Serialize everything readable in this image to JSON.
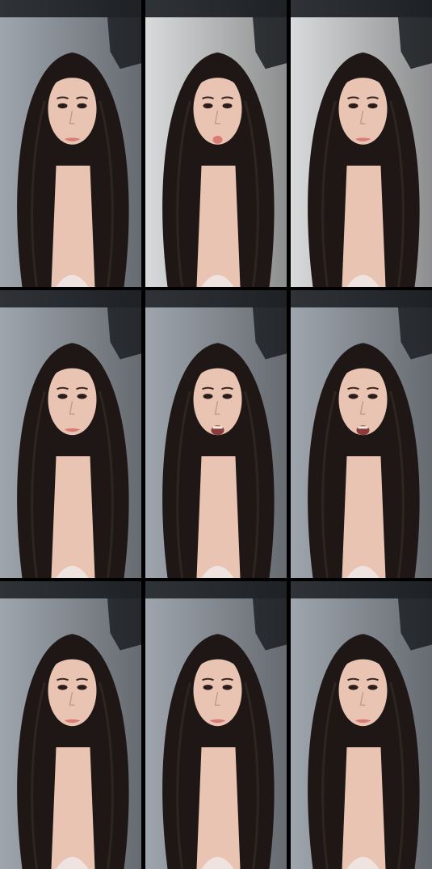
{
  "collage": {
    "rows": 3,
    "columns": 3,
    "tiles": [
      {
        "tone": "cool",
        "mouth": "closed"
      },
      {
        "tone": "bright",
        "mouth": "pucker"
      },
      {
        "tone": "bright",
        "mouth": "closed"
      },
      {
        "tone": "cool",
        "mouth": "closed"
      },
      {
        "tone": "cool",
        "mouth": "open"
      },
      {
        "tone": "cool",
        "mouth": "open"
      },
      {
        "tone": "cool",
        "mouth": "closed"
      },
      {
        "tone": "cool",
        "mouth": "closed"
      },
      {
        "tone": "cool",
        "mouth": "closed"
      }
    ]
  },
  "colors": {
    "border": "#000000",
    "wall_cool": "#9ea5ad",
    "wall_bright": "#d9dadb",
    "shelf_dark": "#2f3338",
    "hair": "#1e1715",
    "skin": "#e9c4b3",
    "lips": "#d97c78",
    "top": "#efe3df"
  }
}
